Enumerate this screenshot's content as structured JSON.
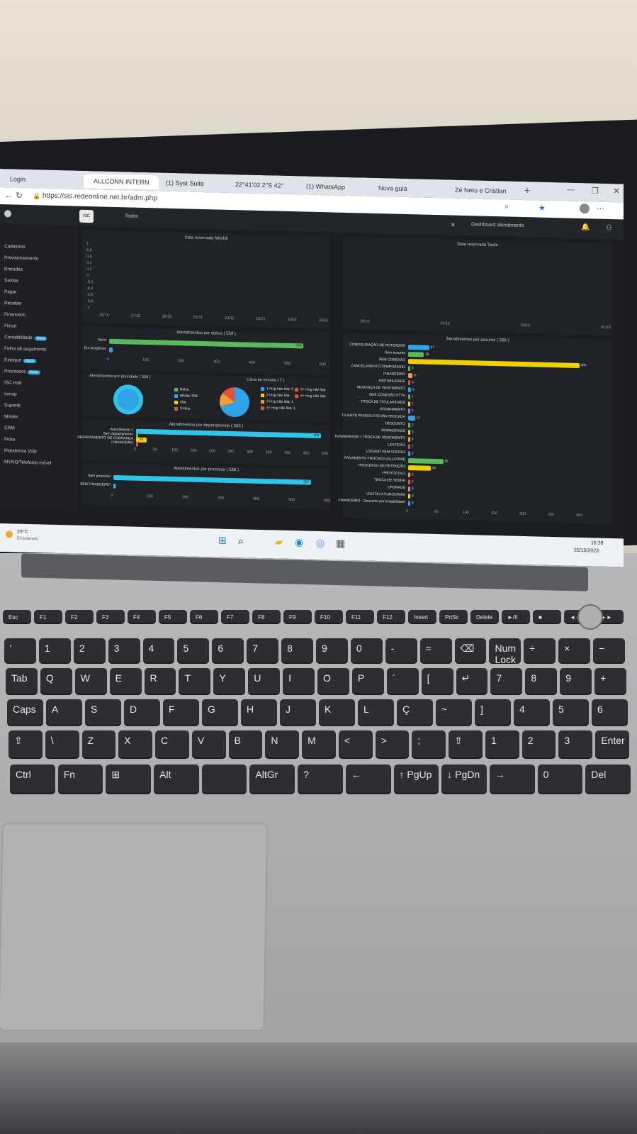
{
  "browser": {
    "tabs": [
      {
        "label": "Login"
      },
      {
        "label": "ALLCONN INTERN"
      },
      {
        "label": "(1) Syst Suite"
      },
      {
        "label": "22°41'02.2\"S 42°"
      },
      {
        "label": "(1) WhatsApp"
      },
      {
        "label": "Nova guia"
      },
      {
        "label": "Zé Neto e Cristian"
      }
    ],
    "url": "https://sis.redeonline.net.br/adm.php"
  },
  "app": {
    "header_select": "Dashboard atendimento",
    "filter_label": "Todos"
  },
  "sidebar": {
    "items": [
      {
        "label": "Cadastros"
      },
      {
        "label": "Provisionamento"
      },
      {
        "label": "Entradas"
      },
      {
        "label": "Saídas"
      },
      {
        "label": "Pagar"
      },
      {
        "label": "Receber"
      },
      {
        "label": "Financeiro"
      },
      {
        "label": "Fiscal"
      },
      {
        "label": "Contabilidade",
        "badge": "Novo"
      },
      {
        "label": "Folha de pagamento"
      },
      {
        "label": "Estoque",
        "badge": "Novo"
      },
      {
        "label": "Processos",
        "badge": "Novo"
      },
      {
        "label": "ISC Hub"
      },
      {
        "label": "Ixmap"
      },
      {
        "label": "Suporte"
      },
      {
        "label": "Mobile"
      },
      {
        "label": "CRM"
      },
      {
        "label": "Frota"
      },
      {
        "label": "Plataforma Voip"
      },
      {
        "label": "MVNO/Telefonia móvel"
      }
    ]
  },
  "charts": {
    "top_left_title": "Data reservada Manhã",
    "top_right_title": "Data reservada Tarde",
    "top_left_x": [
      "25/10",
      "27/10",
      "30/10",
      "01/11",
      "03/11",
      "06/11",
      "10/11",
      "20/11"
    ],
    "top_right_x": [
      "25/10",
      "26/10",
      "30/10",
      "31/10"
    ],
    "top_left_y": [
      "1",
      "0.8",
      "0.6",
      "0.4",
      "0.2",
      "0",
      "-0.2",
      "-0.4",
      "-0.6",
      "-0.8",
      "-1"
    ],
    "status": {
      "title": "Atendimentos por status ( 558 )",
      "rows": [
        {
          "label": "Novo",
          "value": 548,
          "color": "#5cb85c"
        },
        {
          "label": "Em progresso",
          "value": 10,
          "color": "#2fa3e6"
        }
      ],
      "ticks": [
        "0",
        "100",
        "200",
        "300",
        "400",
        "500",
        "600"
      ]
    },
    "priority": {
      "title": "Atendimentos por prioridade ( 558 )",
      "legend": [
        {
          "label": "Baixa",
          "color": "#5cb85c"
        },
        {
          "label": "Média: 558",
          "color": "#2fa3e6"
        },
        {
          "label": "Alta",
          "color": "#f0d000"
        },
        {
          "label": "Crítica",
          "color": "#e0533d"
        }
      ]
    },
    "inbox": {
      "title": "Caixa de entrada ( 7 )",
      "legend": [
        {
          "label": "1 msg não lida: 5",
          "color": "#2fa3e6"
        },
        {
          "label": "2 msg não lida",
          "color": "#f0d000"
        },
        {
          "label": "3 msg não lida: 1",
          "color": "#f39c34"
        },
        {
          "label": "4+ msg não lida: 1",
          "color": "#e0533d"
        },
        {
          "label": "4+ msg não lida",
          "color": "#e0533d"
        },
        {
          "label": "4+ msg não lida",
          "color": "#e0533d"
        }
      ]
    },
    "department": {
      "title": "Atendimentos por departamento ( 558 )",
      "rows": [
        {
          "label": "Atendimento 1",
          "value": 492,
          "color": "#30c5e8"
        },
        {
          "label": "Sem departamento",
          "value": 3,
          "color": "#5cb85c"
        },
        {
          "label": "DEPARTAMENTO DE COBRANÇA",
          "value": 28,
          "color": "#f0d000"
        },
        {
          "label": "FINANCEIRO",
          "value": 5,
          "color": "#e0533d"
        }
      ],
      "ticks": [
        "0",
        "50",
        "100",
        "150",
        "200",
        "250",
        "300",
        "350",
        "400",
        "450",
        "500"
      ]
    },
    "process": {
      "title": "Atendimentos por processo ( 558 )",
      "rows": [
        {
          "label": "Sem processo",
          "value": 557,
          "color": "#30c5e8"
        },
        {
          "label": "SEM FINANCEIRO",
          "value": 1,
          "color": "#30c5e8"
        }
      ],
      "ticks": [
        "0",
        "100",
        "200",
        "300",
        "400",
        "500",
        "600"
      ]
    },
    "subject": {
      "title": "Atendimentos por assunto ( 558 )",
      "rows": [
        {
          "label": "CONFIGURAÇÃO DE ROTEADOR",
          "value": 37,
          "color": "#2fa3e6"
        },
        {
          "label": "Sem assunto",
          "value": 28,
          "color": "#5cb85c"
        },
        {
          "label": "SEM CONEXÃO",
          "value": 302,
          "color": "#f0d000"
        },
        {
          "label": "CANCELAMENTO TEMPORÁRIO",
          "value": 3,
          "color": "#5cb85c"
        },
        {
          "label": "FINANCEIRO",
          "value": 8,
          "color": "#f39c34"
        },
        {
          "label": "INSTABILIDADE",
          "value": 4,
          "color": "#e0533d"
        },
        {
          "label": "MUDANÇA DE VENCIMENTO",
          "value": 5,
          "color": "#2fa3e6"
        },
        {
          "label": "SEM CONEXÃO FTTH",
          "value": 1,
          "color": "#5cb85c"
        },
        {
          "label": "TROCA DE TITULARIDADE",
          "value": 1,
          "color": "#f0d000"
        },
        {
          "label": "ATENDIMENTO",
          "value": 2,
          "color": "#9a7bd8"
        },
        {
          "label": "CLIENTE PASSOU FATURA TROCADA",
          "value": 12,
          "color": "#2fa3e6"
        },
        {
          "label": "DESCONTO",
          "value": 2,
          "color": "#5cb85c"
        },
        {
          "label": "DOWNGRADE",
          "value": 3,
          "color": "#f0d000"
        },
        {
          "label": "DOWNGRADE + TROCA DE VENCIMENTO",
          "value": 3,
          "color": "#f39c34"
        },
        {
          "label": "LENTIDÃO",
          "value": 1,
          "color": "#e0533d"
        },
        {
          "label": "LOGADO SEM ACESSO",
          "value": 2,
          "color": "#2fa3e6"
        },
        {
          "label": "PAGAMENTO TROCADO (ALLCONN)",
          "value": 62,
          "color": "#5cb85c"
        },
        {
          "label": "PROCESSO DE RETENÇÃO",
          "value": 40,
          "color": "#f0d000"
        },
        {
          "label": "PROTOCOLO",
          "value": 3,
          "color": "#f39c34"
        },
        {
          "label": "TROCA DE SENHA",
          "value": 2,
          "color": "#e0533d"
        },
        {
          "label": "UPGRADE",
          "value": 3,
          "color": "#e377c2"
        },
        {
          "label": "VOLTOU A FUNCIONAR",
          "value": 3,
          "color": "#f0d000"
        },
        {
          "label": "FINANCEIRO - Desconto por Instabilidade",
          "value": 3,
          "color": "#2fa3e6"
        }
      ],
      "ticks": [
        "0",
        "50",
        "100",
        "150",
        "200",
        "250",
        "300"
      ]
    }
  },
  "taskbar": {
    "weather_temp": "29°C",
    "weather_desc": "Ensolarado",
    "time": "16:39",
    "date": "25/10/2023"
  },
  "keyboard": {
    "rows": [
      [
        "Esc",
        "F1",
        "F2",
        "F3",
        "F4",
        "F5",
        "F6",
        "F7",
        "F8",
        "F9",
        "F10",
        "F11",
        "F12",
        "Insert",
        "PrtSc",
        "Delete",
        "►/II",
        "■",
        "◄◄",
        "►►"
      ],
      [
        "'",
        "1",
        "2",
        "3",
        "4",
        "5",
        "6",
        "7",
        "8",
        "9",
        "0",
        "-",
        "=",
        "⌫",
        "Num Lock",
        "÷",
        "×",
        "−"
      ],
      [
        "Tab",
        "Q",
        "W",
        "E",
        "R",
        "T",
        "Y",
        "U",
        "I",
        "O",
        "P",
        "´",
        "[",
        "↵",
        "7",
        "8",
        "9",
        "+"
      ],
      [
        "Caps",
        "A",
        "S",
        "D",
        "F",
        "G",
        "H",
        "J",
        "K",
        "L",
        "Ç",
        "~",
        "]",
        "4",
        "5",
        "6"
      ],
      [
        "⇧",
        "\\",
        "Z",
        "X",
        "C",
        "V",
        "B",
        "N",
        "M",
        "<",
        ">",
        ";",
        "⇧",
        "1",
        "2",
        "3",
        "Enter"
      ],
      [
        "Ctrl",
        "Fn",
        "⊞",
        "Alt",
        "",
        "AltGr",
        "?",
        "←",
        "↑ PgUp",
        "↓ PgDn",
        "→",
        "0",
        "Del"
      ]
    ]
  },
  "colors": {
    "dark_bg": "#1b1d21",
    "panel_bg": "#1f2226",
    "accent_blue": "#2fa3e6",
    "accent_green": "#5cb85c",
    "accent_yellow": "#f0d000"
  }
}
